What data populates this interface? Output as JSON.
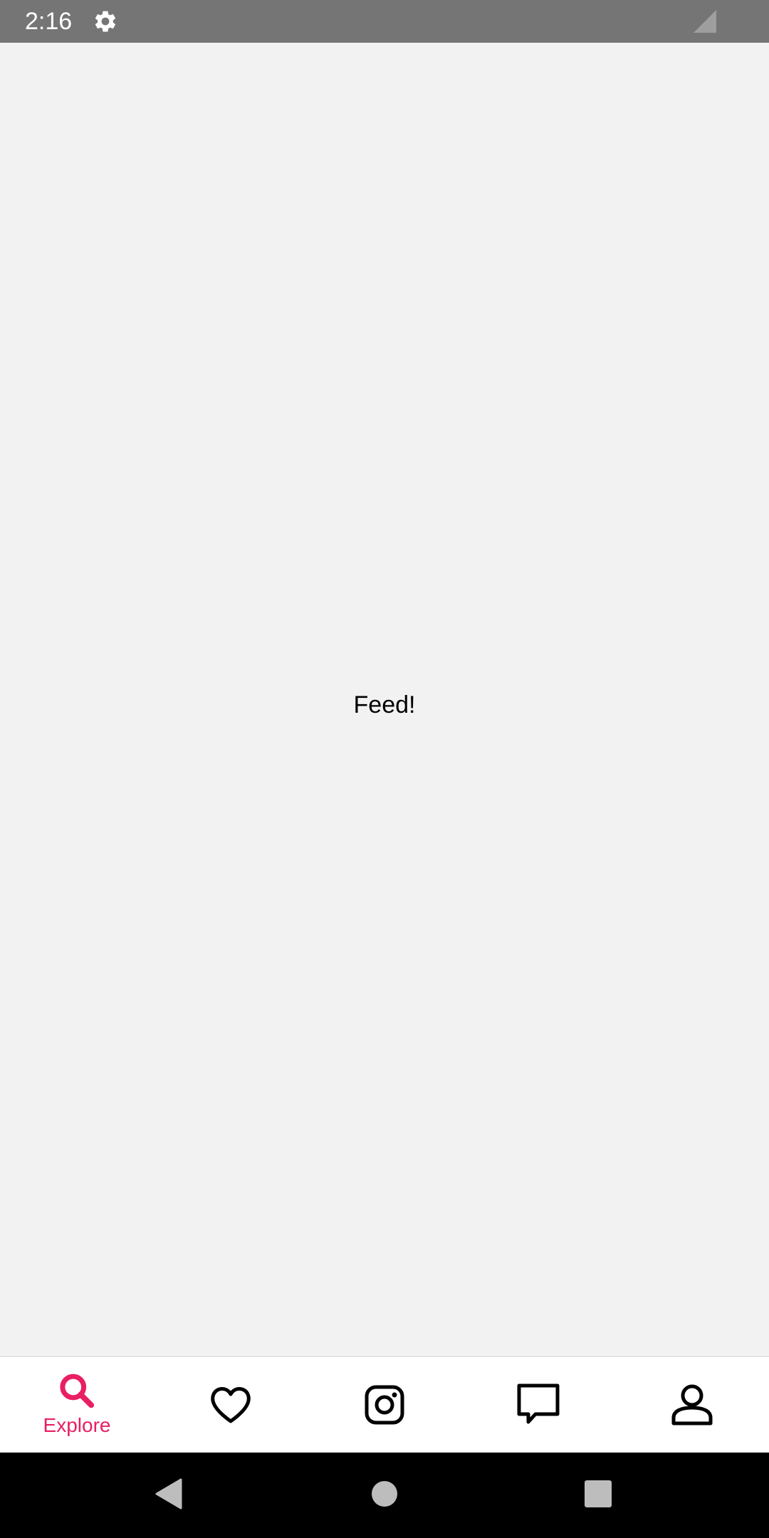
{
  "status_bar": {
    "time": "2:16",
    "icons": [
      "settings-gear-icon",
      "cell-signal-icon"
    ]
  },
  "main": {
    "text": "Feed!"
  },
  "bottom_nav": {
    "active_color": "#e91e63",
    "inactive_color": "#000000",
    "items": [
      {
        "icon": "search-icon",
        "label": "Explore",
        "active": true
      },
      {
        "icon": "heart-icon",
        "label": "",
        "active": false
      },
      {
        "icon": "instagram-camera-icon",
        "label": "",
        "active": false
      },
      {
        "icon": "chat-bubble-icon",
        "label": "",
        "active": false
      },
      {
        "icon": "person-icon",
        "label": "",
        "active": false
      }
    ]
  },
  "system_nav": {
    "icons": [
      "back-triangle-icon",
      "home-circle-icon",
      "recents-square-icon"
    ]
  }
}
